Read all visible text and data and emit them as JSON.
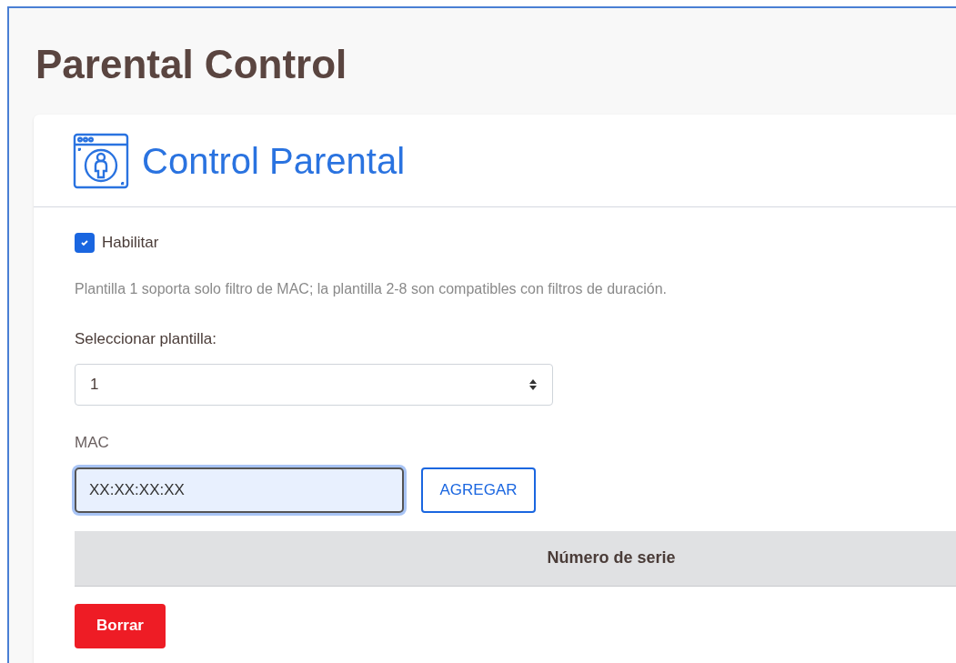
{
  "page_title": "Parental Control",
  "card": {
    "title": "Control Parental"
  },
  "enable": {
    "label": "Habilitar",
    "checked": true
  },
  "help_text": "Plantilla 1 soporta solo filtro de MAC; la plantilla 2-8 son compatibles con filtros de duración.",
  "template_select": {
    "label": "Seleccionar plantilla:",
    "value": "1"
  },
  "mac": {
    "label": "MAC",
    "value": "XX:XX:XX:XX",
    "focused": true
  },
  "add_button": "AGREGAR",
  "table": {
    "columns": [
      "Número de serie"
    ]
  },
  "delete_button": "Borrar"
}
